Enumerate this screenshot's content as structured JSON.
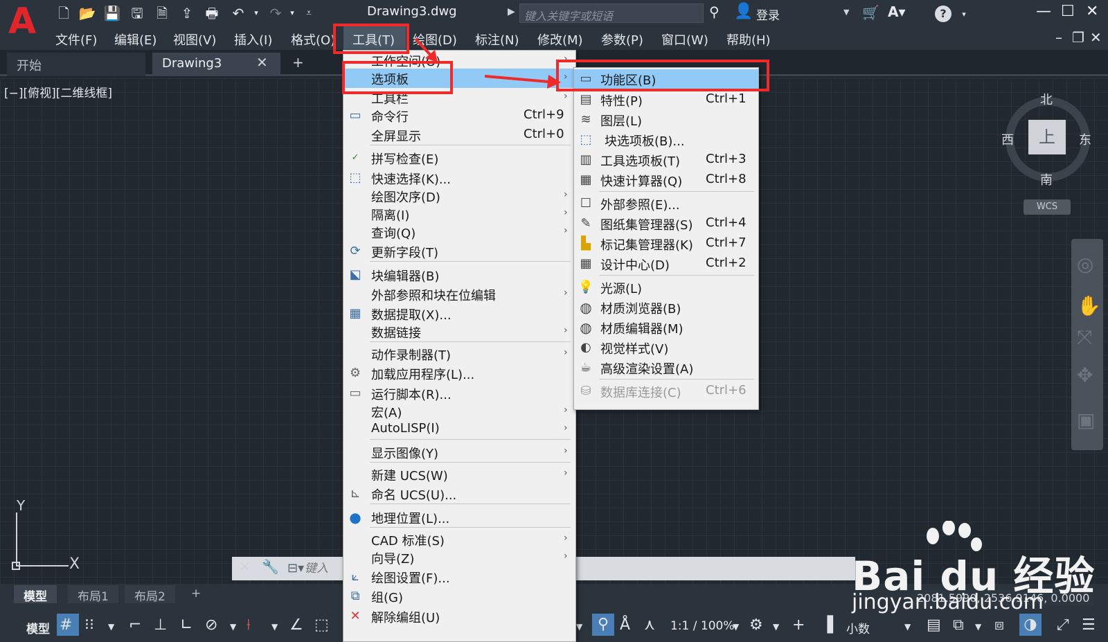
{
  "window": {
    "title": "Drawing3.dwg",
    "search_placeholder": "键入关键字或短语",
    "login_label": "登录"
  },
  "menubar": {
    "items": [
      "文件(F)",
      "编辑(E)",
      "视图(V)",
      "插入(I)",
      "格式(O)",
      "工具(T)",
      "绘图(D)",
      "标注(N)",
      "修改(M)",
      "参数(P)",
      "窗口(W)",
      "帮助(H)"
    ]
  },
  "tabs": {
    "start": "开始",
    "drawing": "Drawing3"
  },
  "viewport": {
    "label": "[−][俯视][二维线框]"
  },
  "viewcube": {
    "top_face": "上",
    "north": "北",
    "south": "南",
    "west": "西",
    "east": "东",
    "wcs": "WCS"
  },
  "ucs": {
    "x": "X",
    "y": "Y"
  },
  "command": {
    "placeholder": "键入"
  },
  "layout_tabs": [
    "模型",
    "布局1",
    "布局2"
  ],
  "statusbar": {
    "model": "模型",
    "scale": "1:1 / 100%",
    "units": "小数",
    "coords": "2081.5990, 2536.9146, 0.0000"
  },
  "tools_menu": {
    "items": [
      {
        "label": "工作空间(O)",
        "shortcut": "",
        "submenu": true
      },
      {
        "label": "选项板",
        "shortcut": "",
        "submenu": true
      },
      {
        "label": "工具栏",
        "shortcut": "",
        "submenu": true
      },
      {
        "label": "命令行",
        "shortcut": "Ctrl+9",
        "submenu": false
      },
      {
        "label": "全屏显示",
        "shortcut": "Ctrl+0",
        "submenu": false
      },
      {
        "label": "拼写检查(E)",
        "shortcut": "",
        "submenu": false
      },
      {
        "label": "快速选择(K)...",
        "shortcut": "",
        "submenu": false
      },
      {
        "label": "绘图次序(D)",
        "shortcut": "",
        "submenu": true
      },
      {
        "label": "隔离(I)",
        "shortcut": "",
        "submenu": true
      },
      {
        "label": "查询(Q)",
        "shortcut": "",
        "submenu": true
      },
      {
        "label": "更新字段(T)",
        "shortcut": "",
        "submenu": false
      },
      {
        "label": "块编辑器(B)",
        "shortcut": "",
        "submenu": false
      },
      {
        "label": "外部参照和块在位编辑",
        "shortcut": "",
        "submenu": true
      },
      {
        "label": "数据提取(X)...",
        "shortcut": "",
        "submenu": false
      },
      {
        "label": "数据链接",
        "shortcut": "",
        "submenu": true
      },
      {
        "label": "动作录制器(T)",
        "shortcut": "",
        "submenu": true
      },
      {
        "label": "加载应用程序(L)...",
        "shortcut": "",
        "submenu": false
      },
      {
        "label": "运行脚本(R)...",
        "shortcut": "",
        "submenu": false
      },
      {
        "label": "宏(A)",
        "shortcut": "",
        "submenu": true
      },
      {
        "label": "AutoLISP(I)",
        "shortcut": "",
        "submenu": true
      },
      {
        "label": "显示图像(Y)",
        "shortcut": "",
        "submenu": true
      },
      {
        "label": "新建 UCS(W)",
        "shortcut": "",
        "submenu": true
      },
      {
        "label": "命名 UCS(U)...",
        "shortcut": "",
        "submenu": false
      },
      {
        "label": "地理位置(L)...",
        "shortcut": "",
        "submenu": false
      },
      {
        "label": "CAD 标准(S)",
        "shortcut": "",
        "submenu": true
      },
      {
        "label": "向导(Z)",
        "shortcut": "",
        "submenu": true
      },
      {
        "label": "绘图设置(F)...",
        "shortcut": "",
        "submenu": false
      },
      {
        "label": "组(G)",
        "shortcut": "",
        "submenu": false
      },
      {
        "label": "解除编组(U)",
        "shortcut": "",
        "submenu": false
      }
    ]
  },
  "palette_submenu": {
    "items": [
      {
        "label": "功能区(B)",
        "shortcut": ""
      },
      {
        "label": "特性(P)",
        "shortcut": "Ctrl+1"
      },
      {
        "label": "图层(L)",
        "shortcut": ""
      },
      {
        "label": "块选项板(B)...",
        "shortcut": ""
      },
      {
        "label": "工具选项板(T)",
        "shortcut": "Ctrl+3"
      },
      {
        "label": "快速计算器(Q)",
        "shortcut": "Ctrl+8"
      },
      {
        "label": "外部参照(E)...",
        "shortcut": ""
      },
      {
        "label": "图纸集管理器(S)",
        "shortcut": "Ctrl+4"
      },
      {
        "label": "标记集管理器(K)",
        "shortcut": "Ctrl+7"
      },
      {
        "label": "设计中心(D)",
        "shortcut": "Ctrl+2"
      },
      {
        "label": "光源(L)",
        "shortcut": ""
      },
      {
        "label": "材质浏览器(B)",
        "shortcut": ""
      },
      {
        "label": "材质编辑器(M)",
        "shortcut": ""
      },
      {
        "label": "视觉样式(V)",
        "shortcut": ""
      },
      {
        "label": "高级渲染设置(A)",
        "shortcut": ""
      },
      {
        "label": "数据库连接(C)",
        "shortcut": "Ctrl+6"
      }
    ]
  },
  "watermark": {
    "brand": "Bai du 经验",
    "url": "jingyan.baidu.com"
  },
  "colors": {
    "highlight": "#ee2a2a",
    "menu_hover": "#91c9f7",
    "canvas": "#212830"
  }
}
